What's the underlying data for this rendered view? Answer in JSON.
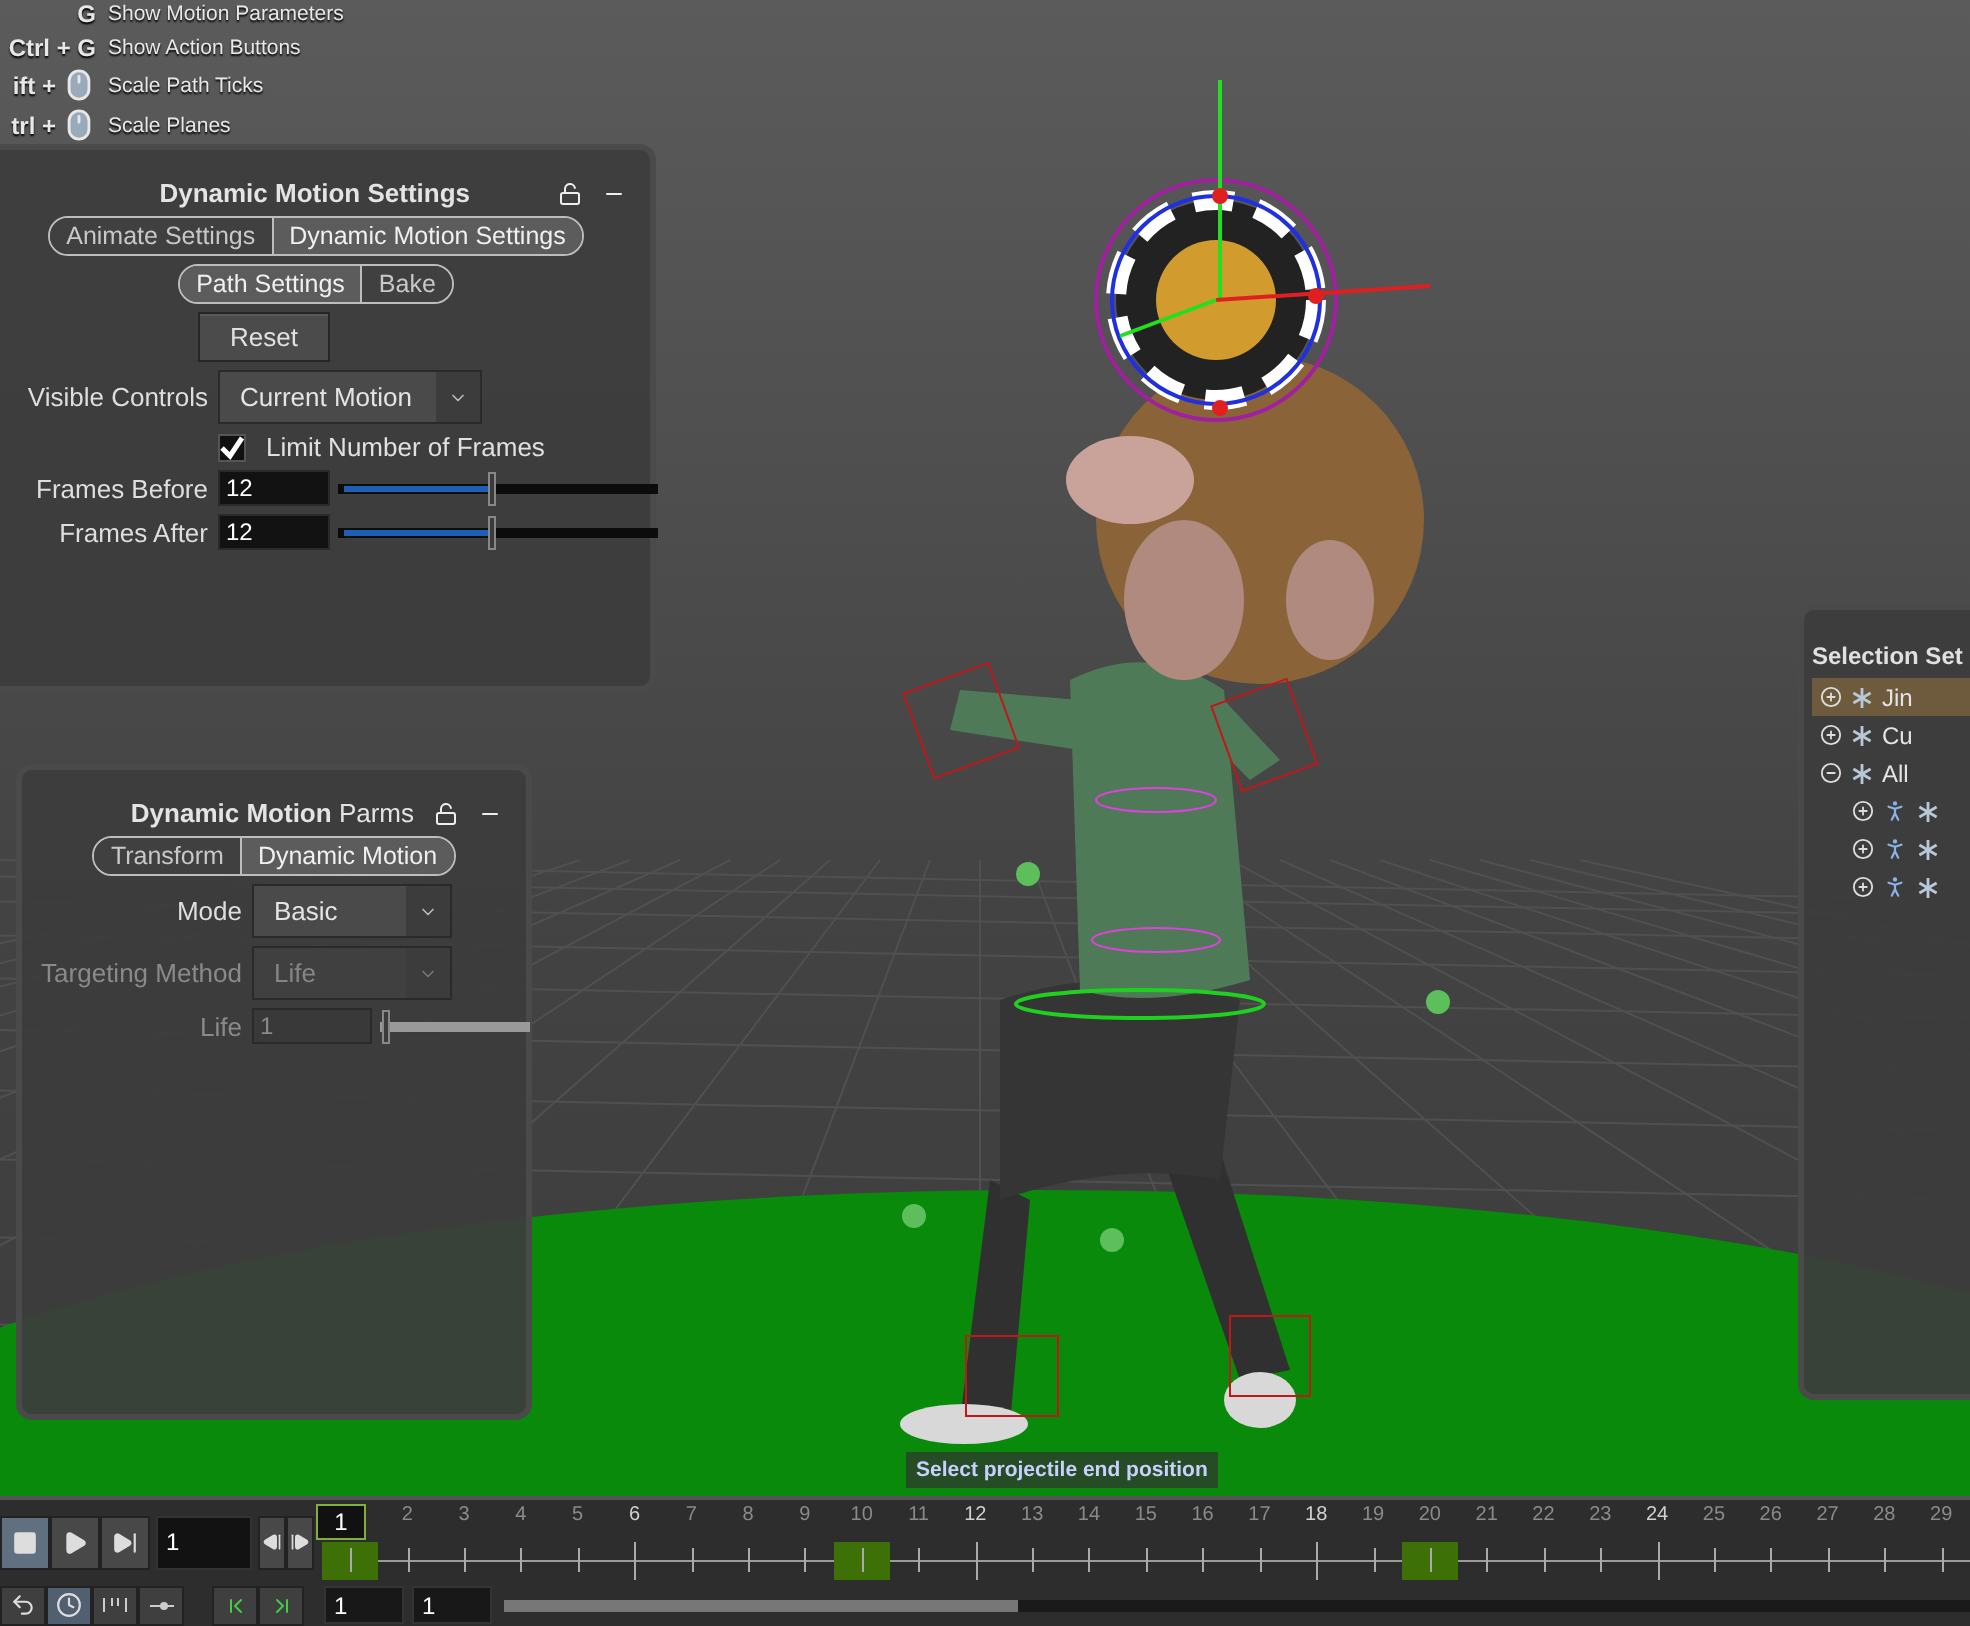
{
  "hotkeys": [
    {
      "keys": "G",
      "mouse": false,
      "action": "Show Motion Parameters"
    },
    {
      "keys": "Ctrl + G",
      "mouse": false,
      "action": "Show Action Buttons"
    },
    {
      "keys": "ift +",
      "mouse": true,
      "action": "Scale Path Ticks"
    },
    {
      "keys": "trl +",
      "mouse": true,
      "action": "Scale Planes"
    }
  ],
  "settings_panel": {
    "title": "Dynamic Motion Settings",
    "tabs": [
      {
        "label": "Animate Settings",
        "selected": false
      },
      {
        "label": "Dynamic Motion Settings",
        "selected": true
      }
    ],
    "subtabs": [
      {
        "label": "Path Settings",
        "selected": true
      },
      {
        "label": "Bake",
        "selected": false
      }
    ],
    "reset_button": "Reset",
    "visible_controls": {
      "label": "Visible Controls",
      "value": "Current Motion"
    },
    "limit_frames": {
      "label": "Limit Number of Frames",
      "checked": true
    },
    "sliders": [
      {
        "label": "Frames Before",
        "value": "12",
        "level": 0.48
      },
      {
        "label": "Frames After",
        "value": "12",
        "level": 0.48
      }
    ]
  },
  "parms_panel": {
    "title": "**Dynamic Motion** Parms",
    "tabs": [
      {
        "label": "Transform",
        "selected": false
      },
      {
        "label": "Dynamic Motion",
        "selected": true
      }
    ],
    "fields": [
      {
        "kind": "dropdown",
        "label": "Mode",
        "value": "Basic",
        "disabled": false
      },
      {
        "kind": "dropdown",
        "label": "Targeting Method",
        "value": "Life",
        "disabled": true
      },
      {
        "kind": "slider",
        "label": "Life",
        "value": "1",
        "level": 0.0,
        "disabled": true
      }
    ]
  },
  "selection_panel": {
    "title": "Selection Set",
    "rows": [
      {
        "label": "Jin",
        "expanded": false,
        "selected": true,
        "children": []
      },
      {
        "label": "Cu",
        "expanded": false,
        "selected": false,
        "children": []
      },
      {
        "label": "All",
        "expanded": true,
        "selected": false,
        "children": [
          {
            "expanded": false,
            "selected": false
          },
          {
            "expanded": false,
            "selected": false
          },
          {
            "expanded": false,
            "selected": false
          }
        ]
      }
    ]
  },
  "tooltip": "Select projectile end position",
  "timeline": {
    "frame_field": "1",
    "range_start": "1",
    "range_end": "1",
    "range_slider": {
      "level": 0.35
    },
    "frames": [
      {
        "label": "1",
        "current": true,
        "key": true,
        "major": false
      },
      {
        "label": "2",
        "current": false,
        "key": false,
        "major": false
      },
      {
        "label": "3",
        "current": false,
        "key": false,
        "major": false
      },
      {
        "label": "4",
        "current": false,
        "key": false,
        "major": false
      },
      {
        "label": "5",
        "current": false,
        "key": false,
        "major": false
      },
      {
        "label": "6",
        "current": false,
        "key": false,
        "major": true
      },
      {
        "label": "7",
        "current": false,
        "key": false,
        "major": false
      },
      {
        "label": "8",
        "current": false,
        "key": false,
        "major": false
      },
      {
        "label": "9",
        "current": false,
        "key": false,
        "major": false
      },
      {
        "label": "10",
        "current": false,
        "key": true,
        "major": false
      },
      {
        "label": "11",
        "current": false,
        "key": false,
        "major": false
      },
      {
        "label": "12",
        "current": false,
        "key": false,
        "major": true
      },
      {
        "label": "13",
        "current": false,
        "key": false,
        "major": false
      },
      {
        "label": "14",
        "current": false,
        "key": false,
        "major": false
      },
      {
        "label": "15",
        "current": false,
        "key": false,
        "major": false
      },
      {
        "label": "16",
        "current": false,
        "key": false,
        "major": false
      },
      {
        "label": "17",
        "current": false,
        "key": false,
        "major": false
      },
      {
        "label": "18",
        "current": false,
        "key": false,
        "major": true
      },
      {
        "label": "19",
        "current": false,
        "key": false,
        "major": false
      },
      {
        "label": "20",
        "current": false,
        "key": true,
        "major": false
      },
      {
        "label": "21",
        "current": false,
        "key": false,
        "major": false
      },
      {
        "label": "22",
        "current": false,
        "key": false,
        "major": false
      },
      {
        "label": "23",
        "current": false,
        "key": false,
        "major": false
      },
      {
        "label": "24",
        "current": false,
        "key": false,
        "major": true
      },
      {
        "label": "25",
        "current": false,
        "key": false,
        "major": false
      },
      {
        "label": "26",
        "current": false,
        "key": false,
        "major": false
      },
      {
        "label": "27",
        "current": false,
        "key": false,
        "major": false
      },
      {
        "label": "28",
        "current": false,
        "key": false,
        "major": false
      },
      {
        "label": "29",
        "current": false,
        "key": false,
        "major": false
      }
    ]
  }
}
